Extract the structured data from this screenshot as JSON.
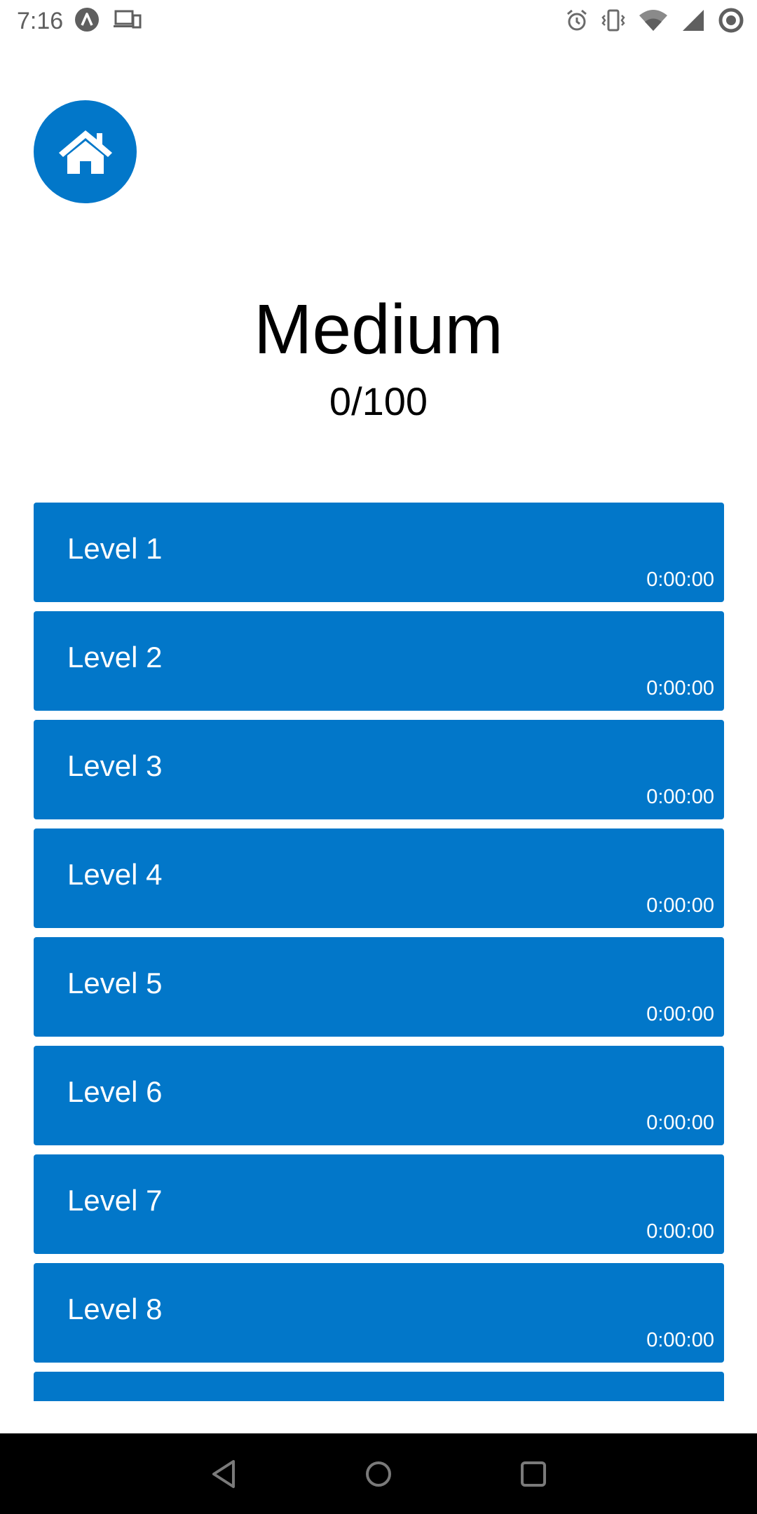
{
  "status_bar": {
    "time": "7:16",
    "left_icons": [
      "app-notification-icon",
      "devices-icon"
    ],
    "right_icons": [
      "alarm-icon",
      "vibrate-icon",
      "wifi-icon",
      "cell-signal-icon",
      "sync-icon"
    ]
  },
  "home_button": {
    "icon": "home-icon"
  },
  "header": {
    "title": "Medium",
    "score": "0/100"
  },
  "levels": [
    {
      "label": "Level 1",
      "time": "0:00:00"
    },
    {
      "label": "Level 2",
      "time": "0:00:00"
    },
    {
      "label": "Level 3",
      "time": "0:00:00"
    },
    {
      "label": "Level 4",
      "time": "0:00:00"
    },
    {
      "label": "Level 5",
      "time": "0:00:00"
    },
    {
      "label": "Level 6",
      "time": "0:00:00"
    },
    {
      "label": "Level 7",
      "time": "0:00:00"
    },
    {
      "label": "Level 8",
      "time": "0:00:00"
    },
    {
      "label": "",
      "time": ""
    }
  ],
  "nav_bar": {
    "buttons": [
      "back-icon",
      "home-circle-icon",
      "recents-icon"
    ]
  },
  "colors": {
    "accent": "#0277c9",
    "background": "#ffffff",
    "nav_bar": "#000000"
  }
}
